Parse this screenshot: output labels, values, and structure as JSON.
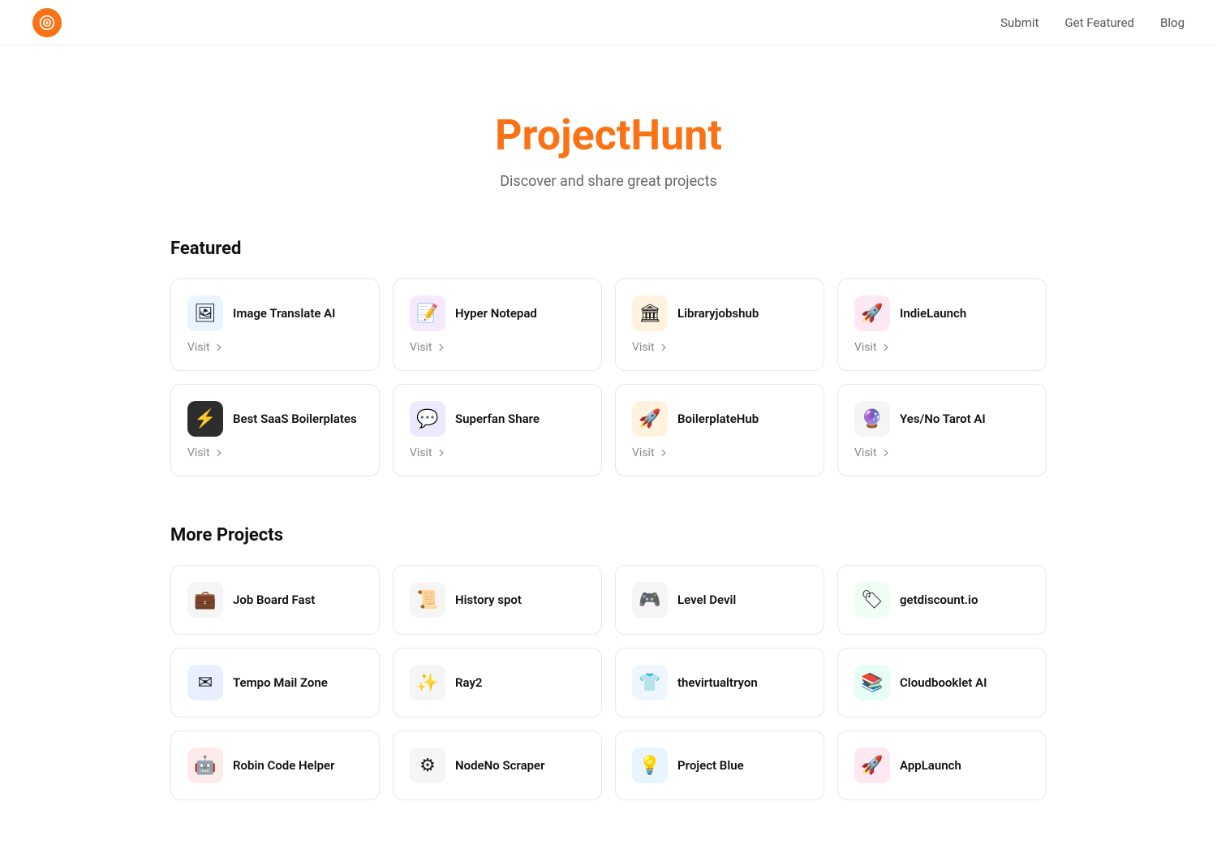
{
  "nav": {
    "submit_label": "Submit",
    "get_featured_label": "Get Featured",
    "blog_label": "Blog"
  },
  "hero": {
    "title": "ProjectHunt",
    "subtitle": "Discover and share great projects"
  },
  "sections": {
    "featured": {
      "title": "Featured",
      "cards": [
        {
          "name": "Image Translate AI",
          "visit": "Visit",
          "icon_type": "img_translate",
          "icon_bg": "#e8f4ff",
          "icon_color": "#3b82f6",
          "icon_symbol": "🖼"
        },
        {
          "name": "Hyper Notepad",
          "visit": "Visit",
          "icon_type": "notepad",
          "icon_bg": "#f5e8ff",
          "icon_color": "#8b5cf6",
          "icon_symbol": "📝"
        },
        {
          "name": "Libraryjobshub",
          "visit": "Visit",
          "icon_type": "library",
          "icon_bg": "#fff3e0",
          "icon_color": "#f97316",
          "icon_symbol": "🏛"
        },
        {
          "name": "IndieLaunch",
          "visit": "Visit",
          "icon_type": "indie",
          "icon_bg": "#fce8f3",
          "icon_color": "#ec4899",
          "icon_symbol": "🚀"
        },
        {
          "name": "Best SaaS Boilerplates",
          "visit": "Visit",
          "icon_type": "saas",
          "icon_bg": "#2d2d2d",
          "icon_color": "#fff",
          "icon_symbol": "⚡"
        },
        {
          "name": "Superfan Share",
          "visit": "Visit",
          "icon_type": "superfan",
          "icon_bg": "#ede9fe",
          "icon_color": "#6366f1",
          "icon_symbol": "💬"
        },
        {
          "name": "BoilerplateHub",
          "visit": "Visit",
          "icon_type": "boilerplate",
          "icon_bg": "#fff3e0",
          "icon_color": "#f97316",
          "icon_symbol": "🚀"
        },
        {
          "name": "Yes/No Tarot AI",
          "visit": "Visit",
          "icon_type": "tarot",
          "icon_bg": "#f5f5f5",
          "icon_color": "#a16207",
          "icon_symbol": "🔮"
        }
      ]
    },
    "more": {
      "title": "More Projects",
      "cards": [
        {
          "name": "Job Board Fast",
          "icon_bg": "#f5f5f5",
          "icon_color": "#555",
          "icon_symbol": "💼"
        },
        {
          "name": "History spot",
          "icon_bg": "#f5f5f5",
          "icon_color": "#555",
          "icon_symbol": "📜"
        },
        {
          "name": "Level Devil",
          "icon_bg": "#f5f5f5",
          "icon_color": "#555",
          "icon_symbol": "🎮"
        },
        {
          "name": "getdiscount.io",
          "icon_bg": "#f0fdf4",
          "icon_color": "#22c55e",
          "icon_symbol": "🏷"
        },
        {
          "name": "Tempo Mail Zone",
          "icon_bg": "#e8f0ff",
          "icon_color": "#3b82f6",
          "icon_symbol": "✉"
        },
        {
          "name": "Ray2",
          "icon_bg": "#f5f5f5",
          "icon_color": "#555",
          "icon_symbol": "✨"
        },
        {
          "name": "thevirtualtryon",
          "icon_bg": "#eff6ff",
          "icon_color": "#3b82f6",
          "icon_symbol": "👕"
        },
        {
          "name": "Cloudbooklet AI",
          "icon_bg": "#e8fdf5",
          "icon_color": "#10b981",
          "icon_symbol": "📚"
        },
        {
          "name": "Robin Code Helper",
          "icon_bg": "#ffeaea",
          "icon_color": "#ef4444",
          "icon_symbol": "🤖"
        },
        {
          "name": "NodeNo Scraper",
          "icon_bg": "#f5f5f5",
          "icon_color": "#555",
          "icon_symbol": "⚙"
        },
        {
          "name": "Project Blue",
          "icon_bg": "#e8f4ff",
          "icon_color": "#3b82f6",
          "icon_symbol": "💡"
        },
        {
          "name": "AppLaunch",
          "icon_bg": "#fce8f3",
          "icon_color": "#ec4899",
          "icon_symbol": "🚀"
        }
      ]
    }
  }
}
